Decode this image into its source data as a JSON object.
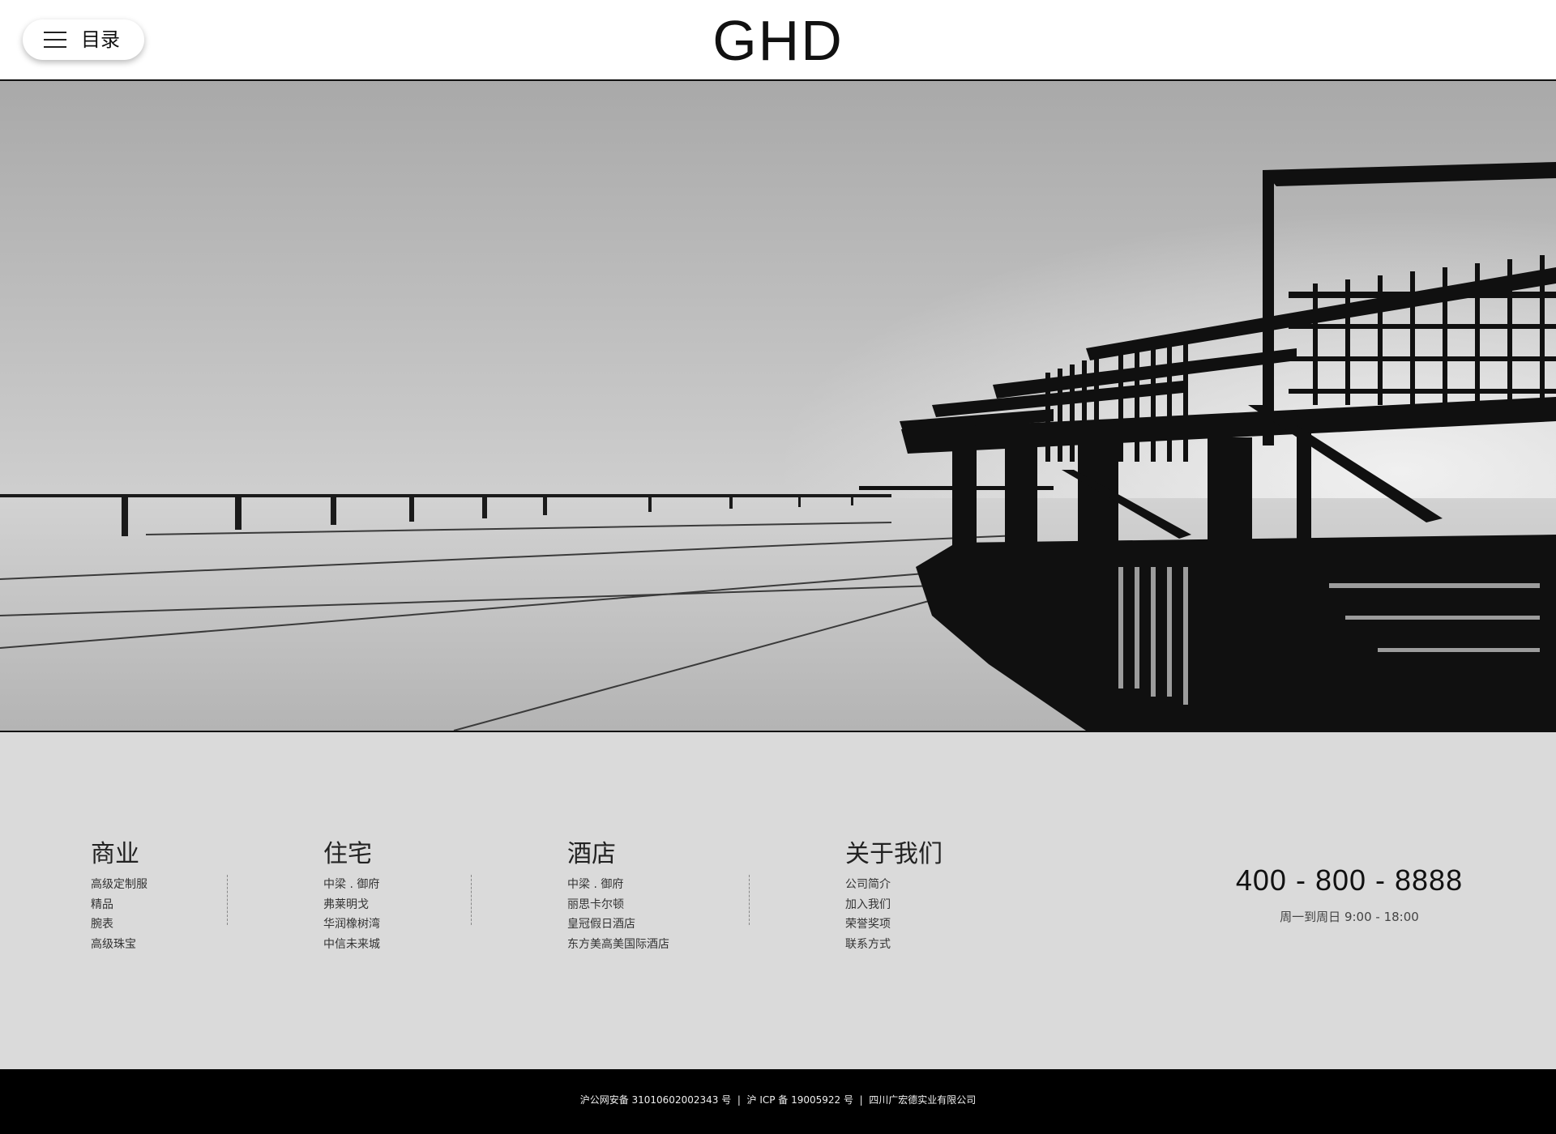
{
  "header": {
    "menu_label": "目录",
    "logo": "GHD"
  },
  "hero": {
    "image_label": "building-reflection-photo"
  },
  "footer": {
    "columns": [
      {
        "title": "商业",
        "items": [
          "高级定制服",
          "精品",
          "腕表",
          "高级珠宝"
        ]
      },
      {
        "title": "住宅",
        "items": [
          "中梁 . 御府",
          "弗莱明戈",
          "华润橡树湾",
          "中信未来城"
        ]
      },
      {
        "title": "酒店",
        "items": [
          "中梁 . 御府",
          "丽思卡尔顿",
          "皇冠假日酒店",
          "东方美高美国际酒店"
        ]
      },
      {
        "title": "关于我们",
        "items": [
          "公司简介",
          "加入我们",
          "荣誉奖项",
          "联系方式"
        ]
      }
    ],
    "phone": "400 - 800 - 8888",
    "hours": "周一到周日 9:00 - 18:00"
  },
  "bottom_bar": {
    "legal": "沪公网安备 31010602002343 号  |  沪 ICP 备 19005922 号  |  四川广宏德实业有限公司"
  },
  "colors": {
    "header_bg": "#ffffff",
    "footer_bg": "#dadada",
    "bottom_bar_bg": "#000000",
    "text": "#111111"
  }
}
